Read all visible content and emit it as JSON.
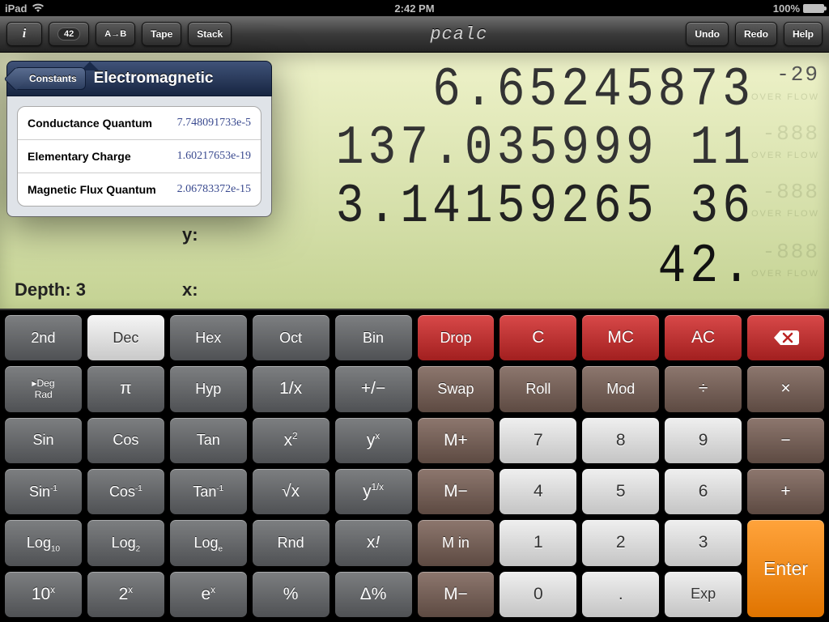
{
  "statusbar": {
    "device": "iPad",
    "time": "2:42 PM",
    "battery_pct": "100%"
  },
  "toolbar": {
    "info_icon": "i",
    "constants_badge": "42",
    "convert_label": "A→B",
    "tape_label": "Tape",
    "stack_label": "Stack",
    "app_title": "pcalc",
    "undo_label": "Undo",
    "redo_label": "Redo",
    "help_label": "Help"
  },
  "display": {
    "rows": [
      {
        "value": "6.65245873",
        "exp": "-29"
      },
      {
        "value": "137.035999 11",
        "exp": ""
      },
      {
        "value": "3.14159265 36",
        "exp": ""
      },
      {
        "value": "42.",
        "exp": ""
      }
    ],
    "overflow_flag": "OVER\nFLOW",
    "exp_ghost": "-888",
    "y_label": "y:",
    "x_label": "x:",
    "depth_label_prefix": "Depth: ",
    "depth_value": "3"
  },
  "popover": {
    "back_label": "Constants",
    "title": "Electromagnetic",
    "items": [
      {
        "name": "Conductance Quantum",
        "value": "7.748091733e-5"
      },
      {
        "name": "Elementary Charge",
        "value": "1.60217653e-19"
      },
      {
        "name": "Magnetic Flux Quantum",
        "value": "2.06783372e-15"
      }
    ]
  },
  "keys": {
    "r0": [
      "2nd",
      "Dec",
      "Hex",
      "Oct",
      "Bin",
      "Drop",
      "C",
      "MC",
      "AC",
      ""
    ],
    "r1_deg": "Deg",
    "r1_rad": "Rad",
    "r1": [
      "π",
      "Hyp",
      "1/x",
      "+/−",
      "Swap",
      "Roll",
      "Mod",
      "÷",
      "×"
    ],
    "r2": [
      "Sin",
      "Cos",
      "Tan",
      "x²",
      "yˣ",
      "M+",
      "7",
      "8",
      "9",
      "−"
    ],
    "r3": [
      "Sin⁻¹",
      "Cos⁻¹",
      "Tan⁻¹",
      "√x",
      "y^(1/x)",
      "M−",
      "4",
      "5",
      "6",
      "+"
    ],
    "r4": [
      "Log₁₀",
      "Log₂",
      "Logₑ",
      "Rnd",
      "x!",
      "M in",
      "1",
      "2",
      "3"
    ],
    "r5": [
      "10ˣ",
      "2ˣ",
      "eˣ",
      "%",
      "Δ%",
      "M−",
      "0",
      ".",
      "Exp"
    ],
    "enter": "Enter"
  }
}
